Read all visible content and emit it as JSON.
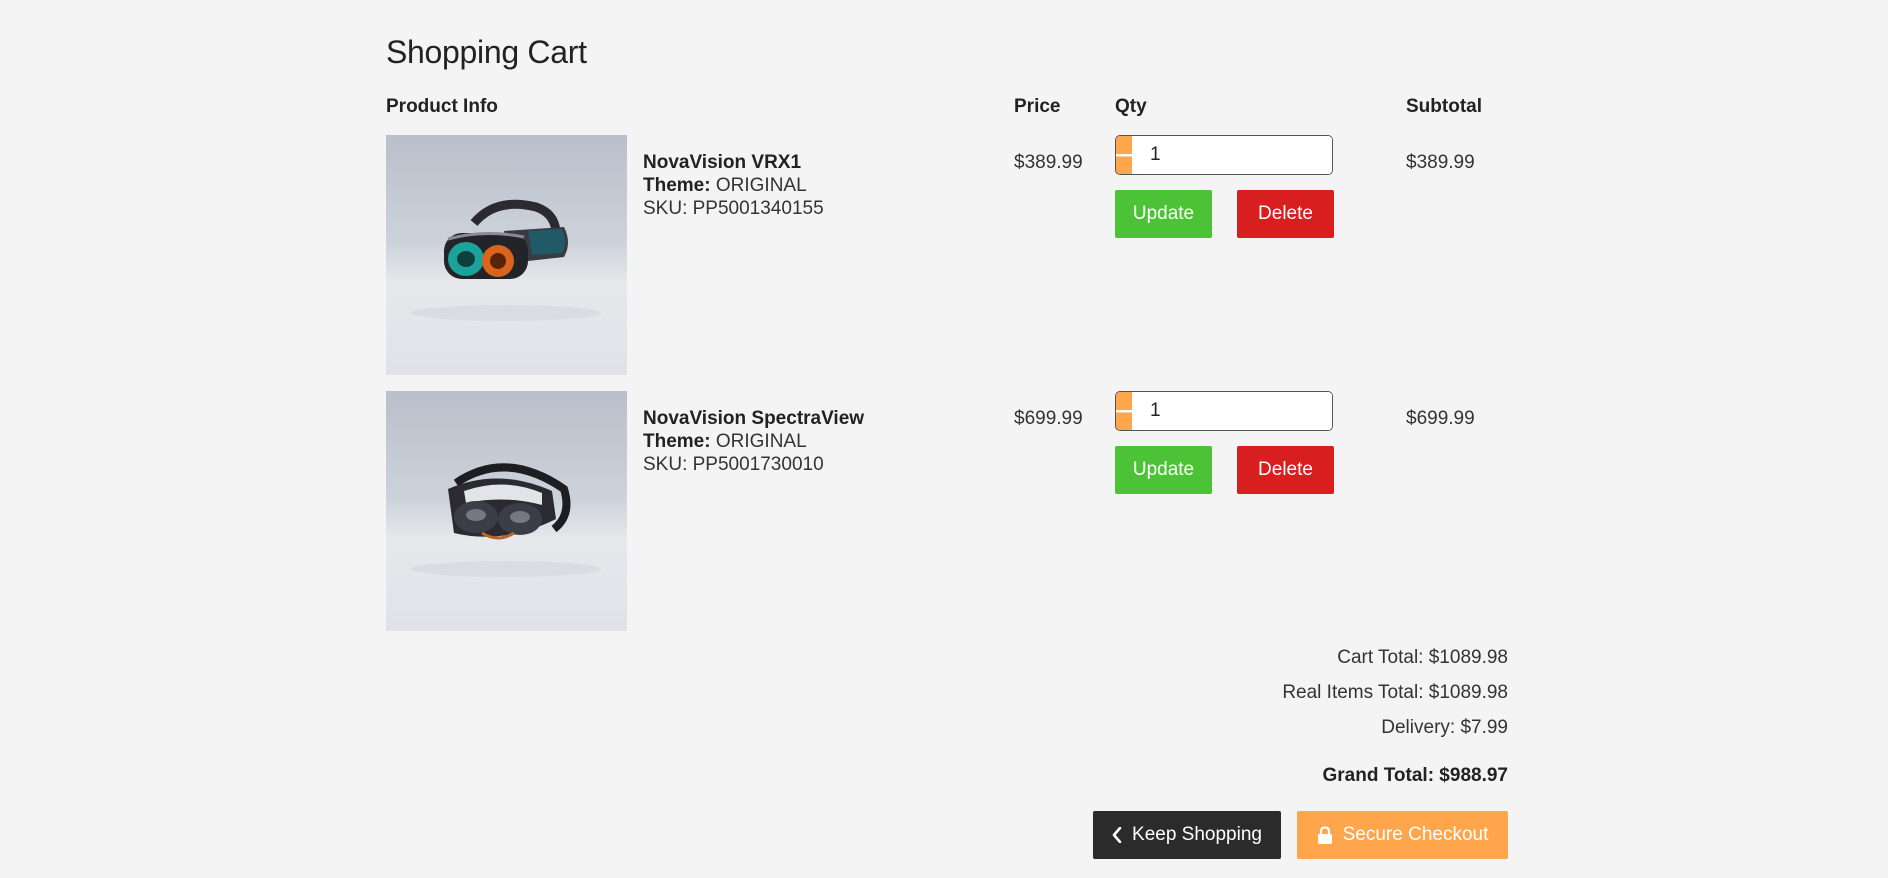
{
  "cart": {
    "title": "Shopping Cart",
    "columns": {
      "product": "Product Info",
      "price": "Price",
      "qty": "Qty",
      "subtotal": "Subtotal"
    },
    "items": [
      {
        "name": "NovaVision VRX1",
        "theme_label": "Theme:",
        "theme": "ORIGINAL",
        "sku": "SKU: PP5001340155",
        "price": "$389.99",
        "qty": "1",
        "subtotal": "$389.99",
        "update_label": "Update",
        "delete_label": "Delete"
      },
      {
        "name": "NovaVision SpectraView",
        "theme_label": "Theme:",
        "theme": "ORIGINAL",
        "sku": "SKU: PP5001730010",
        "price": "$699.99",
        "qty": "1",
        "subtotal": "$699.99",
        "update_label": "Update",
        "delete_label": "Delete"
      }
    ],
    "totals": {
      "cart_total": "Cart Total: $1089.98",
      "real_items_total": "Real Items Total: $1089.98",
      "delivery": "Delivery: $7.99",
      "grand_total": "Grand Total: $988.97"
    },
    "actions": {
      "keep_shopping": "Keep Shopping",
      "secure_checkout": "Secure Checkout"
    }
  },
  "colors": {
    "accent_orange": "#ffa64d",
    "update_green": "#4cc337",
    "delete_red": "#d81e1e",
    "dark_button": "#2b2b2b",
    "background": "#f4f4f4"
  },
  "icons": {
    "qty_minus": "minus-icon",
    "qty_plus": "plus-icon",
    "keep_shopping": "chevron-left-icon",
    "checkout": "lock-icon",
    "product_1": "vr-headset-image",
    "product_2": "vr-headset-image"
  }
}
